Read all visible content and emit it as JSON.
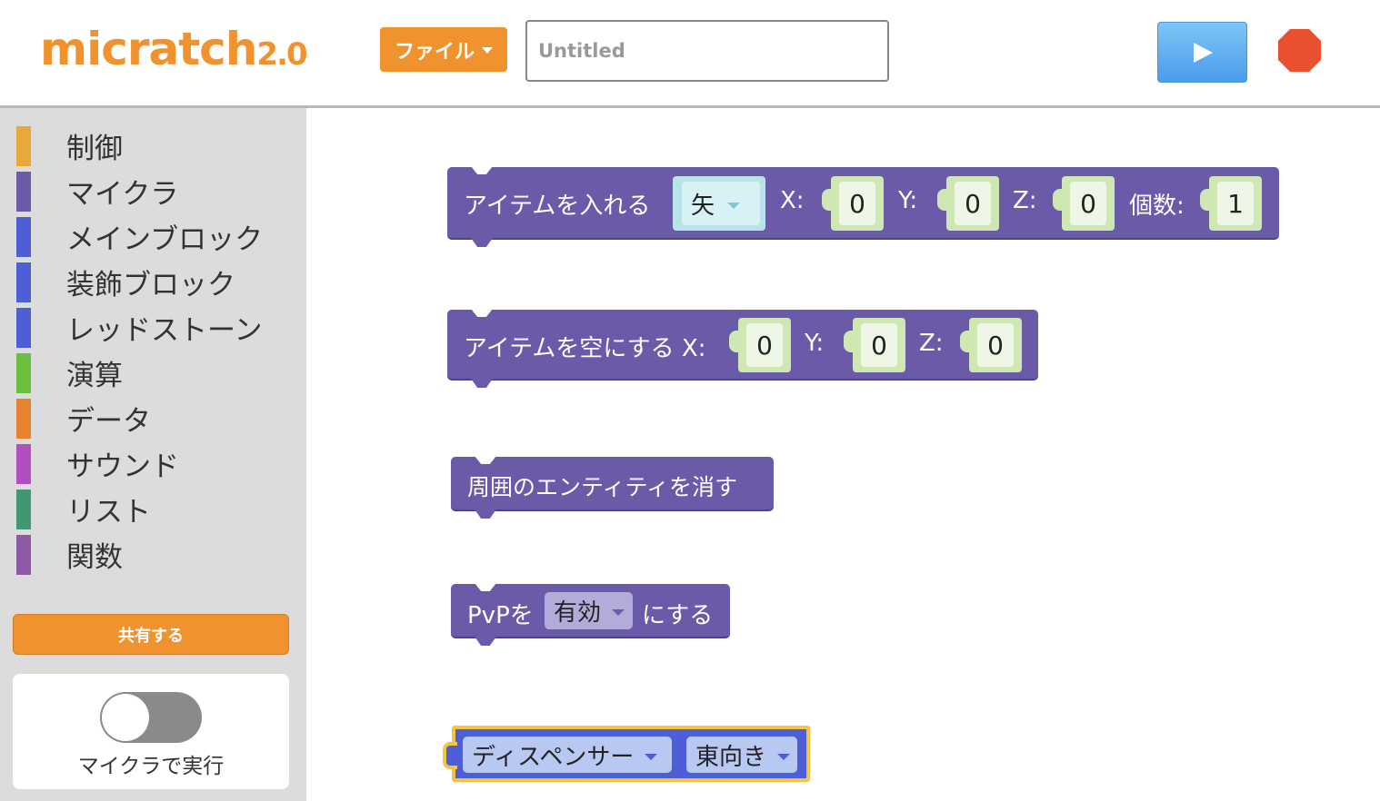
{
  "header": {
    "logo_main": "micratch",
    "logo_version": "2.0",
    "file_button": "ファイル",
    "title_placeholder": "Untitled"
  },
  "sidebar": {
    "categories": [
      {
        "label": "制御",
        "color": "#e8a93a"
      },
      {
        "label": "マイクラ",
        "color": "#6a5aa8"
      },
      {
        "label": "メインブロック",
        "color": "#4c5fd6"
      },
      {
        "label": "装飾ブロック",
        "color": "#4c5fd6"
      },
      {
        "label": "レッドストーン",
        "color": "#4c5fd6"
      },
      {
        "label": "演算",
        "color": "#6abf3d"
      },
      {
        "label": "データ",
        "color": "#e8822f"
      },
      {
        "label": "サウンド",
        "color": "#b34dc4"
      },
      {
        "label": "リスト",
        "color": "#3f9872"
      },
      {
        "label": "関数",
        "color": "#8e5aa8"
      }
    ],
    "share_button": "共有する",
    "run_in_minecraft_label": "マイクラで実行",
    "run_in_minecraft_enabled": false
  },
  "blocks": {
    "put_item": {
      "label": "アイテムを入れる",
      "item": "矢",
      "x_label": "X:",
      "x": "0",
      "y_label": "Y:",
      "y": "0",
      "z_label": "Z:",
      "z": "0",
      "count_label": "個数:",
      "count": "1"
    },
    "empty_item": {
      "label": "アイテムを空にする X:",
      "x": "0",
      "y_label": "Y:",
      "y": "0",
      "z_label": "Z:",
      "z": "0"
    },
    "clear_entities": {
      "label": "周囲のエンティティを消す"
    },
    "pvp": {
      "label_before": "PvPを",
      "value": "有効",
      "label_after": "にする"
    },
    "dispenser": {
      "block": "ディスペンサー",
      "direction": "東向き"
    }
  },
  "colors": {
    "accent_orange": "#f0922d",
    "minecraft_block": "#6a5aa8",
    "main_block": "#4c5fd6",
    "stop_red": "#e8502f"
  }
}
